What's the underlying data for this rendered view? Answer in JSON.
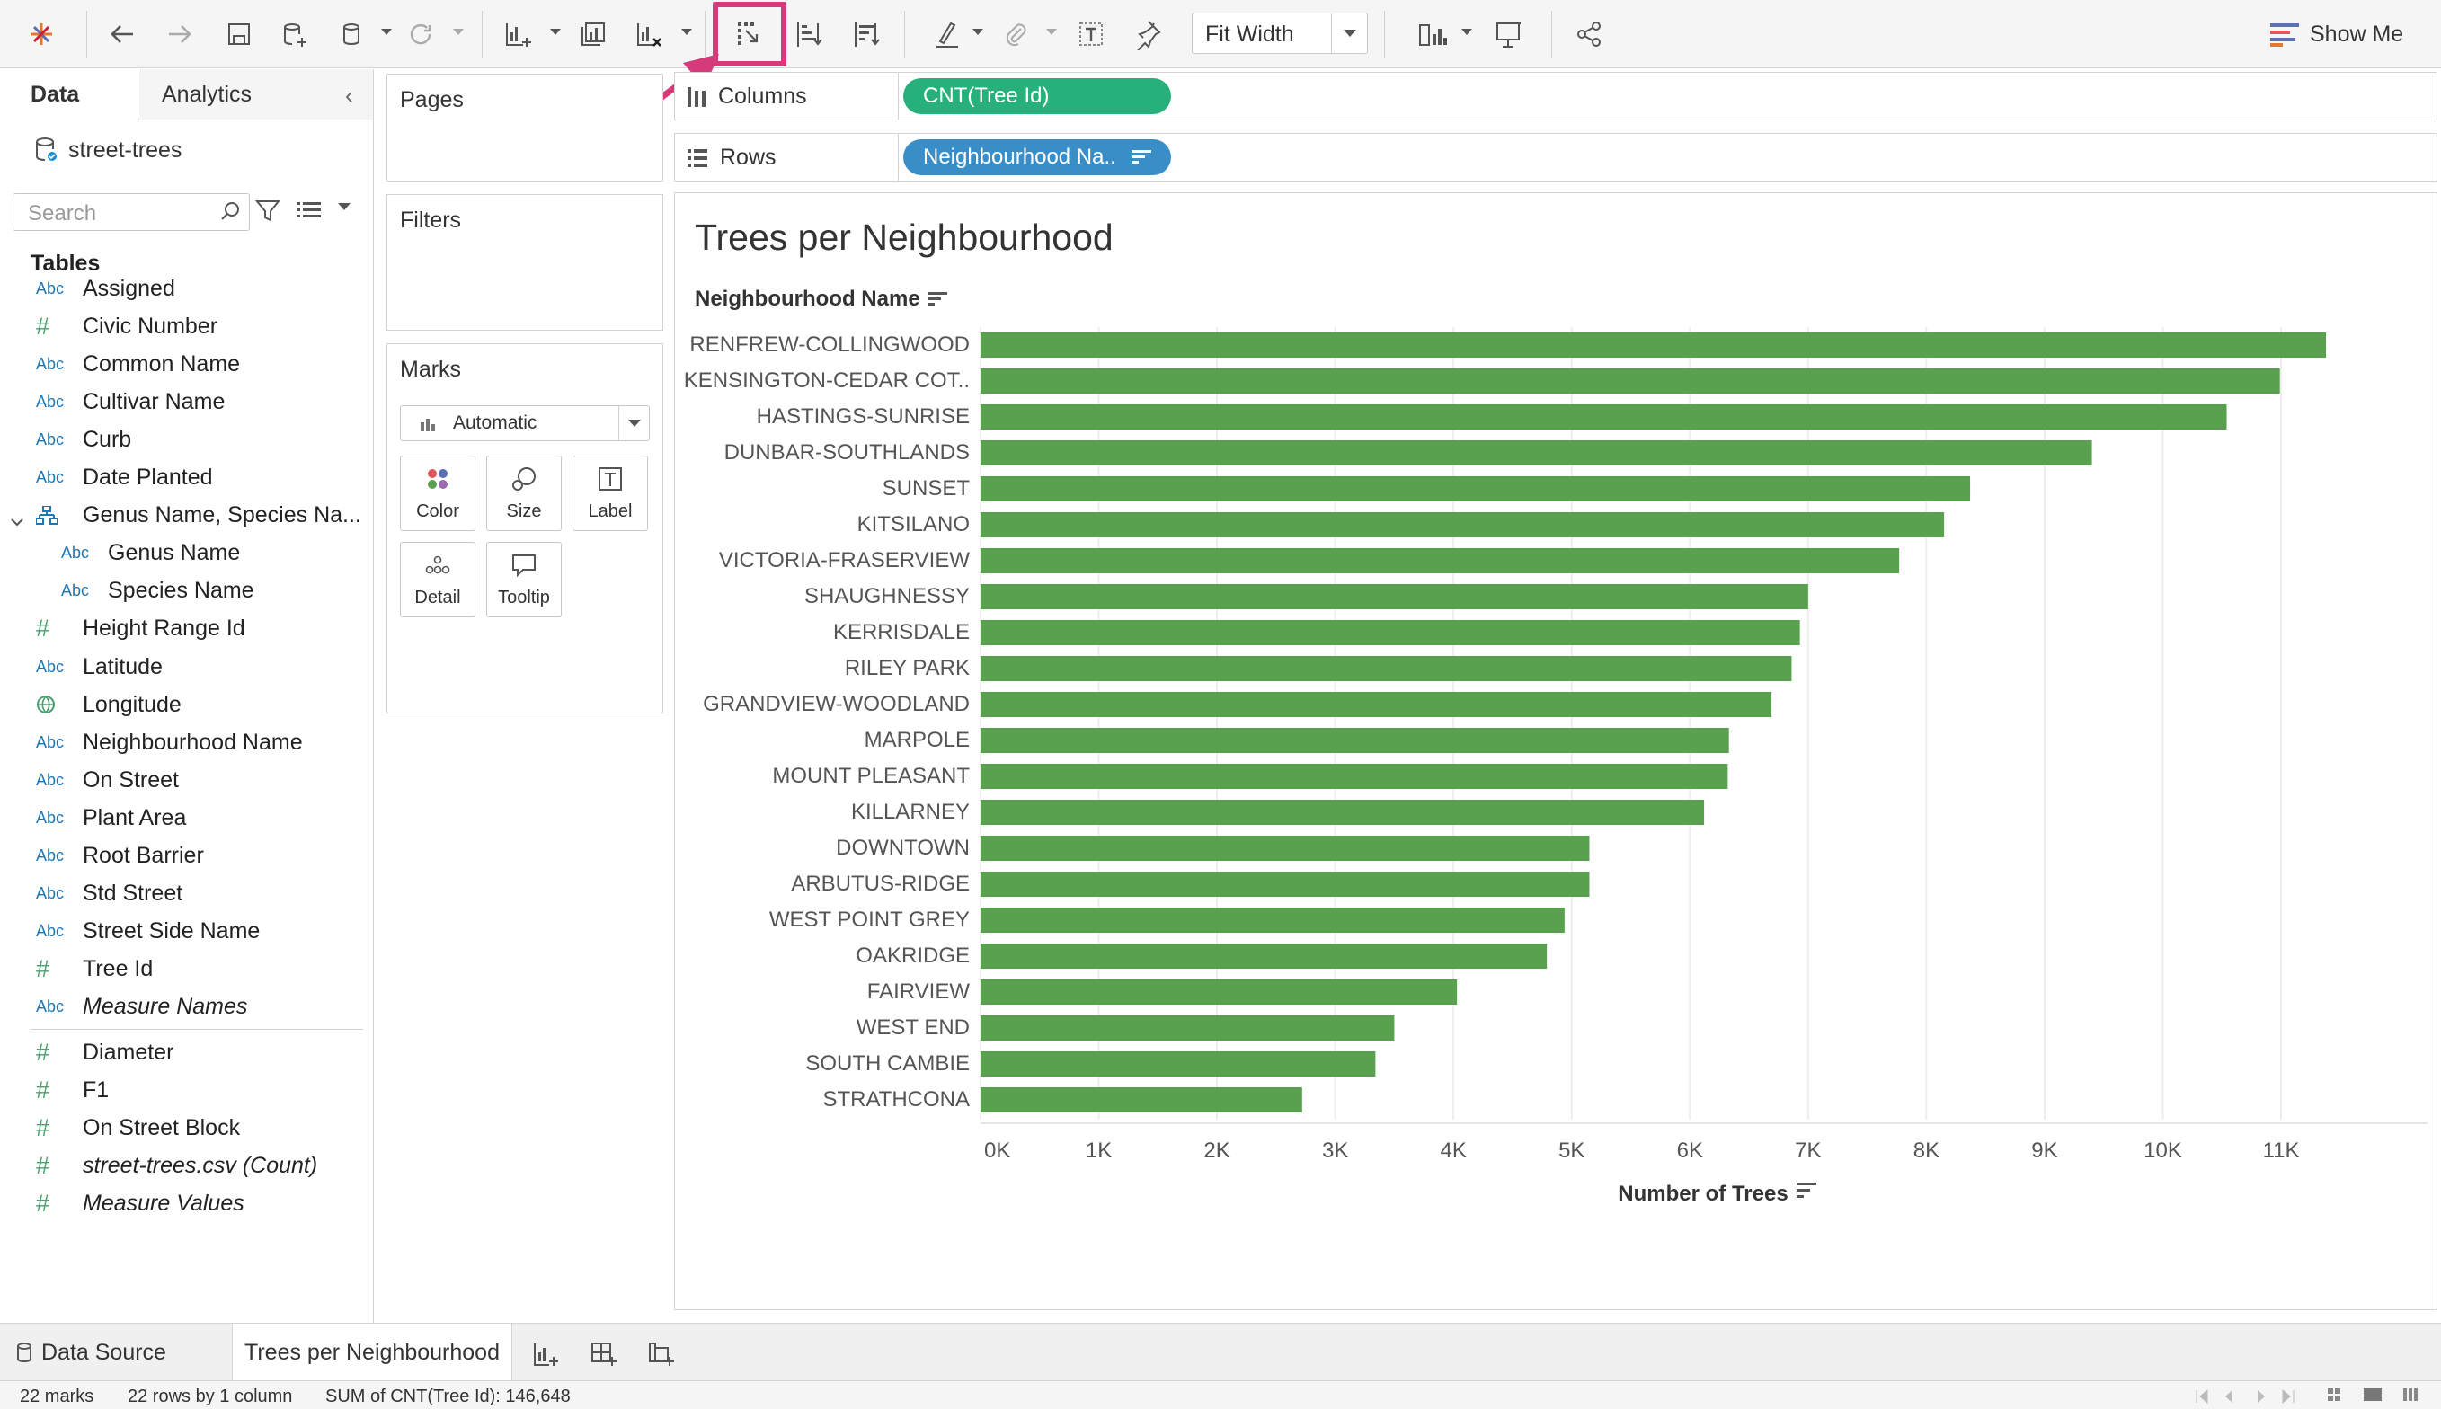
{
  "toolbar": {
    "fit_label": "Fit Width",
    "show_me_label": "Show Me"
  },
  "data_pane": {
    "tab_data": "Data",
    "tab_analytics": "Analytics",
    "datasource": "street-trees",
    "search_placeholder": "Search",
    "tables_header": "Tables",
    "fields": [
      {
        "type": "Abc",
        "name": "Assigned"
      },
      {
        "type": "#",
        "name": "Civic Number"
      },
      {
        "type": "Abc",
        "name": "Common Name"
      },
      {
        "type": "Abc",
        "name": "Cultivar Name"
      },
      {
        "type": "Abc",
        "name": "Curb"
      },
      {
        "type": "Abc",
        "name": "Date Planted"
      },
      {
        "type": "hierarchy",
        "name": "Genus Name, Species Na..."
      },
      {
        "type": "Abc",
        "name": "Genus Name"
      },
      {
        "type": "Abc",
        "name": "Species Name"
      },
      {
        "type": "#",
        "name": "Height Range Id"
      },
      {
        "type": "Abc",
        "name": "Latitude"
      },
      {
        "type": "globe",
        "name": "Longitude"
      },
      {
        "type": "Abc",
        "name": "Neighbourhood Name"
      },
      {
        "type": "Abc",
        "name": "On Street"
      },
      {
        "type": "Abc",
        "name": "Plant Area"
      },
      {
        "type": "Abc",
        "name": "Root Barrier"
      },
      {
        "type": "Abc",
        "name": "Std Street"
      },
      {
        "type": "Abc",
        "name": "Street Side Name"
      },
      {
        "type": "#",
        "name": "Tree Id"
      },
      {
        "type": "Abc",
        "name": "Measure Names"
      }
    ],
    "measures": [
      {
        "type": "#",
        "name": "Diameter"
      },
      {
        "type": "#",
        "name": "F1"
      },
      {
        "type": "#",
        "name": "On Street Block"
      },
      {
        "type": "#",
        "name": "street-trees.csv (Count)"
      },
      {
        "type": "#",
        "name": "Measure Values"
      }
    ]
  },
  "cards": {
    "pages": "Pages",
    "filters": "Filters",
    "marks": "Marks",
    "marks_type": "Automatic",
    "mark_buttons": [
      "Color",
      "Size",
      "Label",
      "Detail",
      "Tooltip"
    ]
  },
  "shelves": {
    "columns_label": "Columns",
    "columns_pill": "CNT(Tree Id)",
    "rows_label": "Rows",
    "rows_pill": "Neighbourhood Na.."
  },
  "chart_data": {
    "type": "bar",
    "title": "Trees per Neighbourhood",
    "row_header": "Neighbourhood Name",
    "xlabel": "Number of Trees",
    "xlim": [
      0,
      12000
    ],
    "tick_labels": [
      "0K",
      "1K",
      "2K",
      "3K",
      "4K",
      "5K",
      "6K",
      "7K",
      "8K",
      "9K",
      "10K",
      "11K"
    ],
    "tick_values": [
      0,
      1000,
      2000,
      3000,
      4000,
      5000,
      6000,
      7000,
      8000,
      9000,
      10000,
      11000
    ],
    "bar_color": "#59a14f",
    "categories": [
      "RENFREW-COLLINGWOOD",
      "KENSINGTON-CEDAR COT..",
      "HASTINGS-SUNRISE",
      "DUNBAR-SOUTHLANDS",
      "SUNSET",
      "KITSILANO",
      "VICTORIA-FRASERVIEW",
      "SHAUGHNESSY",
      "KERRISDALE",
      "RILEY PARK",
      "GRANDVIEW-WOODLAND",
      "MARPOLE",
      "MOUNT PLEASANT",
      "KILLARNEY",
      "DOWNTOWN",
      "ARBUTUS-RIDGE",
      "WEST POINT GREY",
      "OAKRIDGE",
      "FAIRVIEW",
      "WEST END",
      "SOUTH CAMBIE",
      "STRATHCONA"
    ],
    "values": [
      11380,
      10990,
      10540,
      9400,
      8370,
      8150,
      7770,
      7000,
      6930,
      6860,
      6690,
      6330,
      6320,
      6120,
      5150,
      5150,
      4940,
      4790,
      4030,
      3500,
      3340,
      2720
    ]
  },
  "sheets": {
    "data_source": "Data Source",
    "current": "Trees per Neighbourhood"
  },
  "status": {
    "marks": "22 marks",
    "rows_cols": "22 rows by 1 column",
    "sum": "SUM of CNT(Tree Id): 146,648"
  }
}
